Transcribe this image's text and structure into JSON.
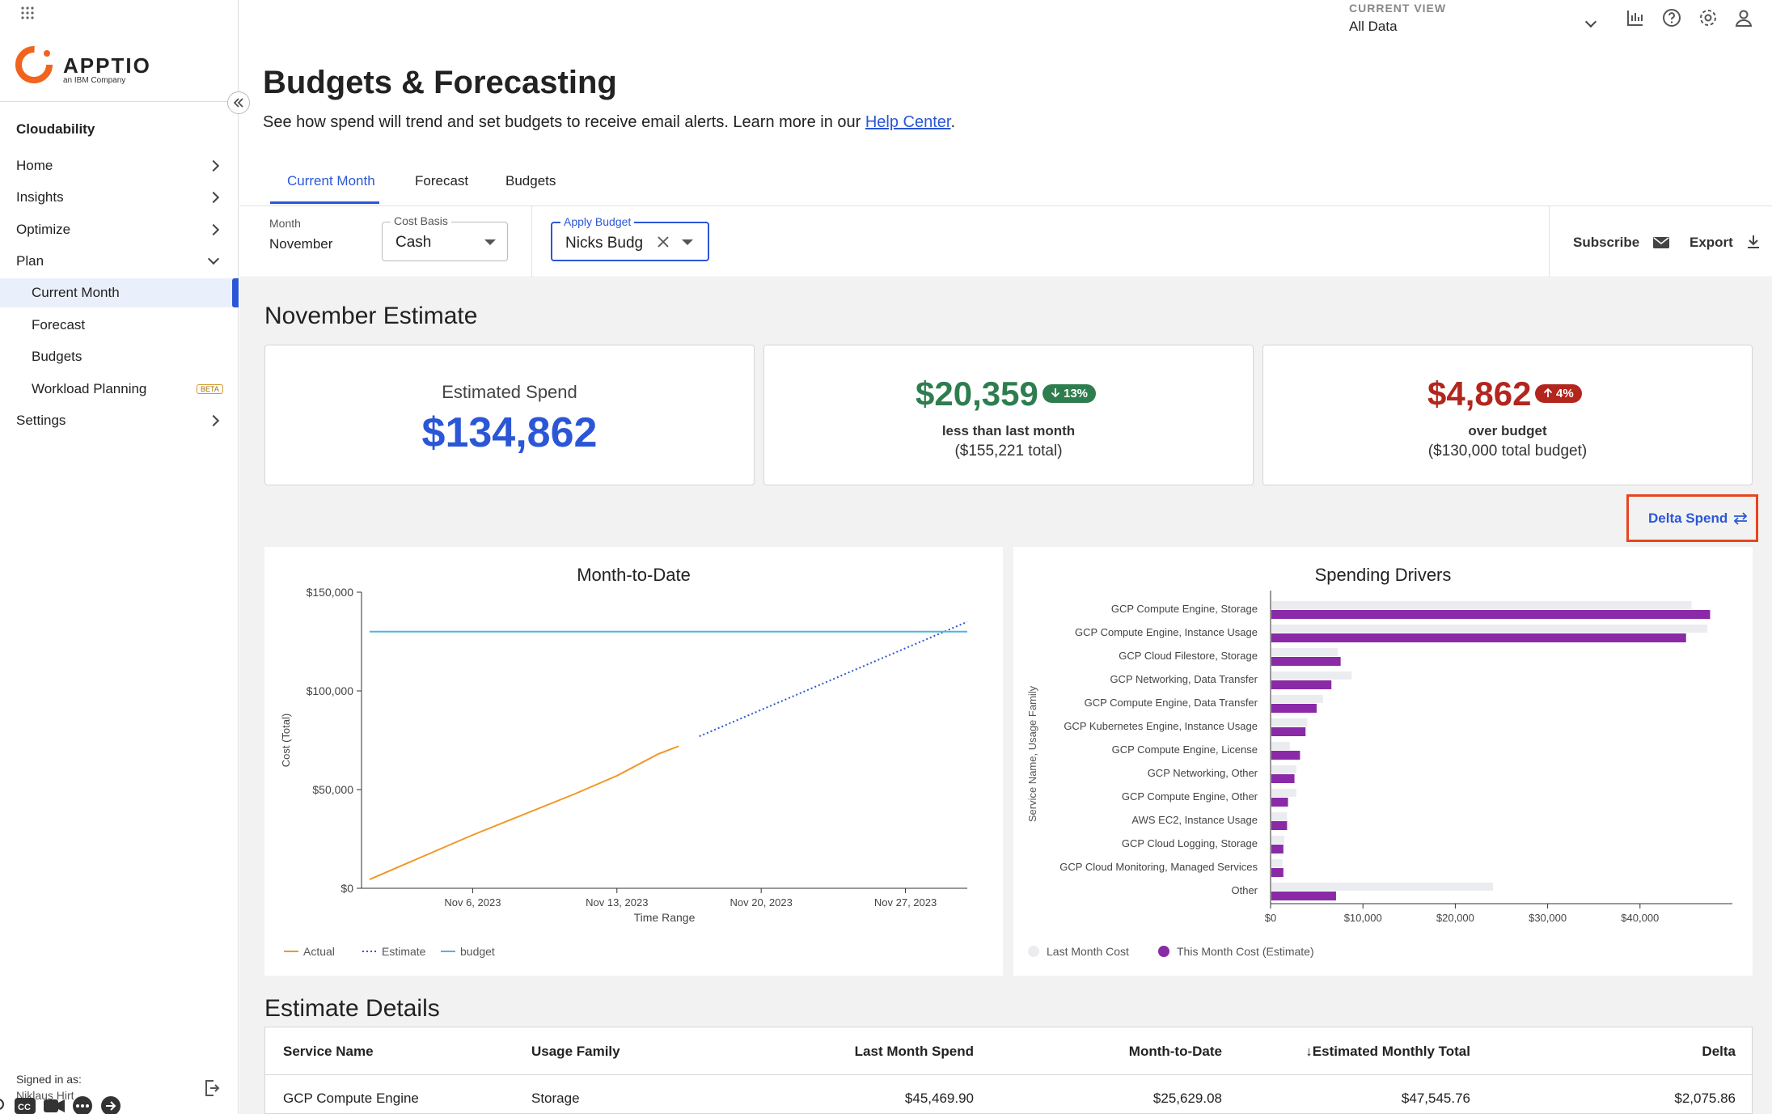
{
  "top_bar": {
    "current_view_label": "CURRENT VIEW",
    "current_view_value": "All Data",
    "icons": [
      "chart-icon",
      "help-icon",
      "gear-icon",
      "user-icon"
    ]
  },
  "sidebar": {
    "logo_text": "APPTIO",
    "logo_sub": "an IBM Company",
    "app_name": "Cloudability",
    "items": [
      {
        "label": "Home"
      },
      {
        "label": "Insights"
      },
      {
        "label": "Optimize"
      },
      {
        "label": "Plan"
      },
      {
        "label": "Current Month"
      },
      {
        "label": "Forecast"
      },
      {
        "label": "Budgets"
      },
      {
        "label": "Workload Planning",
        "badge": "BETA"
      },
      {
        "label": "Settings"
      }
    ],
    "signed_in_label": "Signed in as:",
    "signed_in_name": "Niklaus Hirt"
  },
  "page": {
    "title": "Budgets & Forecasting",
    "subtitle": "See how spend will trend and set budgets to receive email alerts. Learn more in our ",
    "subtitle_link": "Help Center",
    "subtitle_end": "."
  },
  "tabs": [
    {
      "label": "Current Month",
      "active": true
    },
    {
      "label": "Forecast"
    },
    {
      "label": "Budgets"
    }
  ],
  "filters": {
    "month_label": "Month",
    "month_value": "November",
    "cost_basis_label": "Cost Basis",
    "cost_basis_value": "Cash",
    "apply_budget_label": "Apply Budget",
    "apply_budget_value": "Nicks Budget",
    "subscribe_label": "Subscribe",
    "export_label": "Export"
  },
  "estimate": {
    "section_title": "November Estimate",
    "estimated_label": "Estimated Spend",
    "estimated_value": "$134,862",
    "card2_value": "$20,359",
    "card2_pill": "13%",
    "card2_line1": "less than last month",
    "card2_line2": "($155,221 total)",
    "card3_value": "$4,862",
    "card3_pill": "4%",
    "card3_line1": "over budget",
    "card3_line2": "($130,000 total budget)",
    "delta_spend_label": "Delta Spend",
    "colors": {
      "blue": "#2b57d6",
      "green": "#2e7d4f",
      "red": "#b3261e"
    }
  },
  "chart_data": [
    {
      "type": "line",
      "title": "Month-to-Date",
      "xlabel": "Time Range",
      "ylabel": "Cost (Total)",
      "x_ticks": [
        "Nov 6, 2023",
        "Nov 13, 2023",
        "Nov 20, 2023",
        "Nov 27, 2023"
      ],
      "y_ticks": [
        "$0",
        "$50,000",
        "$100,000",
        "$150,000"
      ],
      "ylim": [
        0,
        150000
      ],
      "xlim": [
        "2023-11-01",
        "2023-11-30"
      ],
      "series": [
        {
          "name": "Actual",
          "color": "#f0982a",
          "x": [
            "2023-11-01",
            "2023-11-06",
            "2023-11-11",
            "2023-11-13",
            "2023-11-15",
            "2023-11-16"
          ],
          "values": [
            4500,
            27000,
            48000,
            57000,
            68000,
            72000
          ]
        },
        {
          "name": "Estimate",
          "color": "#2b57d6",
          "dash": true,
          "x": [
            "2023-11-17",
            "2023-11-30"
          ],
          "values": [
            77000,
            135000
          ]
        },
        {
          "name": "budget",
          "color": "#4fb3e0",
          "x": [
            "2023-11-01",
            "2023-11-30"
          ],
          "values": [
            130000,
            130000
          ]
        }
      ],
      "legend": "bottom-left"
    },
    {
      "type": "bar",
      "orientation": "horizontal",
      "title": "Spending Drivers",
      "ylabel": "Service Name, Usage Family",
      "x_ticks": [
        "$0",
        "$10,000",
        "$20,000",
        "$30,000",
        "$40,000"
      ],
      "xlim": [
        0,
        50000
      ],
      "categories": [
        "GCP Compute Engine, Storage",
        "GCP Compute Engine, Instance Usage",
        "GCP Cloud Filestore, Storage",
        "GCP Networking, Data Transfer",
        "GCP Compute Engine, Data Transfer",
        "GCP Kubernetes Engine, Instance Usage",
        "GCP Compute Engine, License",
        "GCP Networking, Other",
        "GCP Compute Engine, Other",
        "AWS EC2, Instance Usage",
        "GCP Cloud Logging, Storage",
        "GCP Cloud Monitoring, Managed Services",
        "Other"
      ],
      "series": [
        {
          "name": "Last Month Cost",
          "color": "#ebecf0",
          "values": [
            45500,
            47200,
            7200,
            8700,
            5600,
            3900,
            2000,
            2700,
            2700,
            1700,
            1400,
            1200,
            24000
          ]
        },
        {
          "name": "This Month Cost (Estimate)",
          "color": "#8a2aa7",
          "values": [
            47500,
            44900,
            7500,
            6500,
            4900,
            3700,
            3100,
            2500,
            1800,
            1700,
            1300,
            1300,
            7000
          ]
        }
      ],
      "legend": "bottom-left"
    }
  ],
  "details": {
    "section_title": "Estimate Details",
    "columns": [
      "Service Name",
      "Usage Family",
      "Last Month Spend",
      "Month-to-Date",
      "Estimated Monthly Total",
      "Delta"
    ],
    "rows": [
      [
        "GCP Compute Engine",
        "Storage",
        "$45,469.90",
        "$25,629.08",
        "$47,545.76",
        "$2,075.86"
      ]
    ]
  }
}
